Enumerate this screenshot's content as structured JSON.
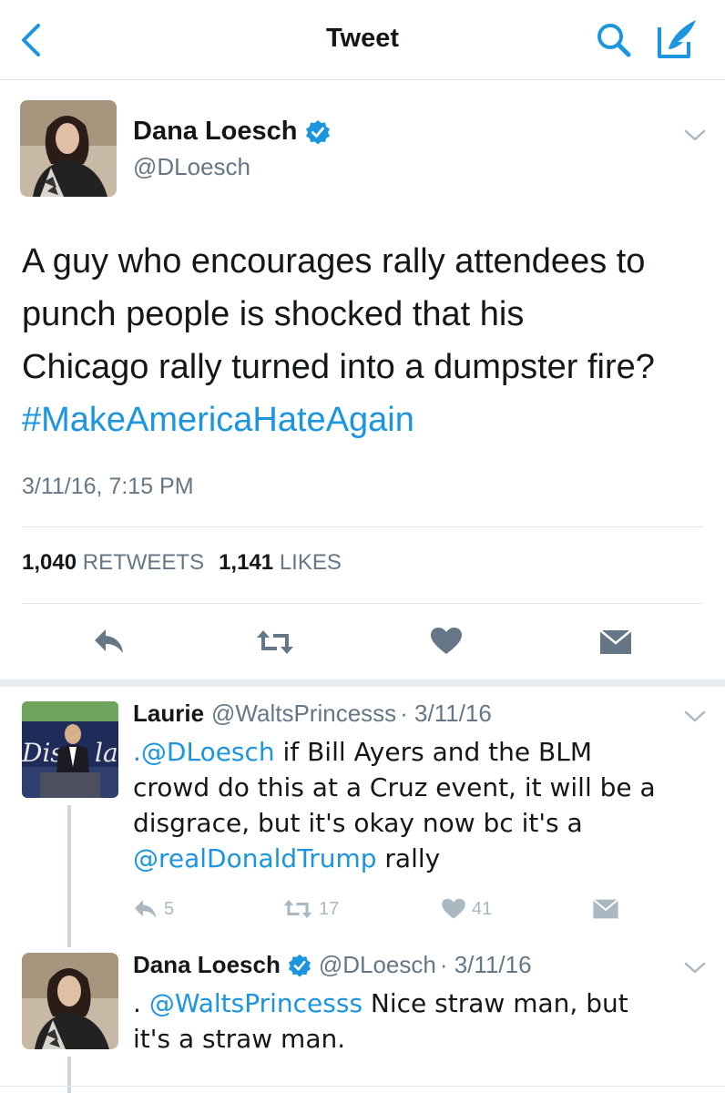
{
  "navbar": {
    "title": "Tweet"
  },
  "tweet": {
    "author_name": "Dana Loesch",
    "author_handle": "@DLoesch",
    "text_lines": [
      "A guy who encourages rally attendees to",
      "punch people is shocked that his",
      "Chicago rally turned into a dumpster fire?"
    ],
    "hashtag": "#MakeAmericaHateAgain",
    "timestamp": "3/11/16, 7:15 PM",
    "retweets_count": "1,040",
    "retweets_label": "RETWEETS",
    "likes_count": "1,141",
    "likes_label": "LIKES"
  },
  "replies": [
    {
      "name": "Laurie",
      "handle": "@WaltsPrincesss",
      "date": "· 3/11/16",
      "line1_mention": ".@DLoesch",
      "line1_rest": " if Bill Ayers and the BLM",
      "line2": "crowd do this at a Cruz event, it will be a",
      "line3": "disgrace, but it's okay now bc it's a",
      "line4_mention": "@realDonaldTrump",
      "line4_rest": " rally",
      "reply_count": "5",
      "retweet_count": "17",
      "like_count": "41"
    },
    {
      "name": "Dana Loesch",
      "handle": "@DLoesch",
      "date": "· 3/11/16",
      "line1_prefix": ". ",
      "line1_mention": "@WaltsPrincesss",
      "line1_rest": " Nice straw man, but",
      "line2": "it's a straw man."
    }
  ],
  "icons": {
    "back": "chevron-left-icon",
    "search": "search-icon",
    "compose": "compose-icon",
    "verified": "verified-badge-icon",
    "reply": "reply-icon",
    "retweet": "retweet-icon",
    "like": "heart-icon",
    "dm": "envelope-icon"
  },
  "colors": {
    "accent": "#1b95e0",
    "text": "#14171a",
    "muted": "#657786",
    "icon_gray": "#657786",
    "icon_light": "#aab8c2"
  }
}
